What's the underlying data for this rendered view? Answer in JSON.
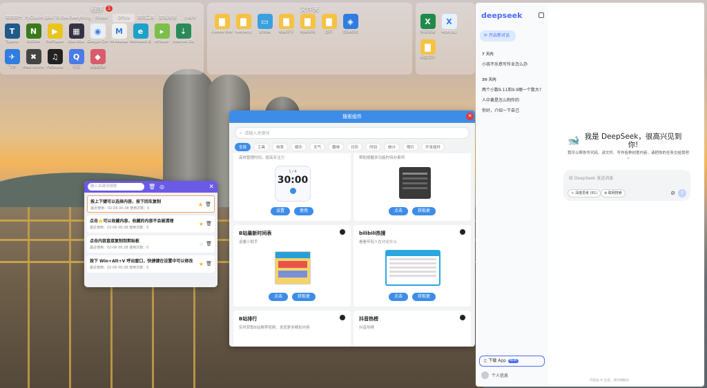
{
  "desktop": {
    "programs": {
      "title": "程序",
      "badge": "1",
      "categories": [
        "常用软件",
        "PyCharm 2022.3",
        "Bat To Exe Converter",
        "Everything",
        "Finder",
        "Office",
        "常用工具",
        "游戏/影音",
        "小程序"
      ],
      "icons": [
        {
          "label": "Typora",
          "icon": "typora-icon",
          "color": "#1f5a8a",
          "glyph": "T"
        },
        {
          "label": "NVIDIA",
          "icon": "nvidia-icon",
          "color": "#3a7a1a",
          "glyph": "N"
        },
        {
          "label": "PotPlayer",
          "icon": "potplayer-icon",
          "color": "#e7c51e",
          "glyph": "▶"
        },
        {
          "label": "Dev Box",
          "icon": "devbox-icon",
          "color": "#334",
          "glyph": "▦"
        },
        {
          "label": "Google Chrome",
          "icon": "chrome-icon",
          "color": "#e9eef5",
          "glyph": "◉"
        },
        {
          "label": "Mindwise",
          "icon": "mindwise-icon",
          "color": "#f0f0f0",
          "glyph": "M"
        },
        {
          "label": "Microsoft Edge",
          "icon": "edge-icon",
          "color": "#1da1c8",
          "glyph": "e"
        },
        {
          "label": "ePlayer",
          "icon": "player-icon",
          "color": "#7bbf4a",
          "glyph": "▸"
        },
        {
          "label": "Internet Download",
          "icon": "idm-icon",
          "color": "#2a8a5a",
          "glyph": "⇣"
        },
        {
          "label": "飞书",
          "icon": "feishu-icon",
          "color": "#2f7de0",
          "glyph": "✈"
        },
        {
          "label": "Hide Uninstaller",
          "icon": "uninstaller-icon",
          "color": "#444",
          "glyph": "✖"
        },
        {
          "label": "FxSound",
          "icon": "fxsound-icon",
          "color": "#222",
          "glyph": "♫"
        },
        {
          "label": "夸克",
          "icon": "quark-icon",
          "color": "#4a7be8",
          "glyph": "Q"
        },
        {
          "label": "桌面整理",
          "icon": "desktop-organizer-icon",
          "color": "#d85c6a",
          "glyph": "◆"
        }
      ]
    },
    "folders": {
      "title": "文件夹",
      "icons": [
        {
          "label": "Cookie Editor",
          "icon": "folder-icon",
          "color": "#f5c244",
          "glyph": "▇"
        },
        {
          "label": "huojiang",
          "icon": "folder-icon",
          "color": "#f5c244",
          "glyph": "▇"
        },
        {
          "label": "此电脑",
          "icon": "computer-icon",
          "color": "#3aa0e0",
          "glyph": "▭"
        },
        {
          "label": "电脑文件",
          "icon": "folder-icon",
          "color": "#f5c244",
          "glyph": "▇"
        },
        {
          "label": "电脑游戏",
          "icon": "folder-icon",
          "color": "#f5c244",
          "glyph": "▇"
        },
        {
          "label": "图片",
          "icon": "folder-icon",
          "color": "#f5c244",
          "glyph": "▇"
        },
        {
          "label": "图像处理",
          "icon": "app-icon",
          "color": "#2f7de0",
          "glyph": "◈"
        }
      ]
    },
    "files": {
      "icons": [
        {
          "label": "恢复数据",
          "icon": "excel-file-icon",
          "color": "#1e8a4c",
          "glyph": "X"
        },
        {
          "label": "logo.jpg",
          "icon": "image-file-icon",
          "color": "#e8f0fb",
          "glyph": "X"
        },
        {
          "label": "网盘文件",
          "icon": "folder-icon",
          "color": "#f5c244",
          "glyph": "▇"
        }
      ]
    }
  },
  "plugin_window": {
    "title": "搜索组件",
    "search_placeholder": "请输入关键词",
    "chips": [
      "全部",
      "工具",
      "效率",
      "娱乐",
      "天气",
      "趣味",
      "日历",
      "时间",
      "统计",
      "照片",
      "开发组件"
    ],
    "cards": [
      {
        "title": "",
        "desc": "高效管理时间，提高专注力",
        "preview": "30:00",
        "preview_sub": "1 / 4",
        "buttons": [
          "设置",
          "使用"
        ]
      },
      {
        "title": "",
        "desc": "帮助提醒多功能的待办事项",
        "preview": "",
        "buttons": [
          "点击",
          "获取更"
        ]
      },
      {
        "title": "B站最新时间表",
        "desc": "追番小助手",
        "buttons": [
          "点击",
          "获取更"
        ]
      },
      {
        "title": "bilibili热搜",
        "desc": "看看年轻人在讨论什么",
        "buttons": [
          "点击",
          "获取更"
        ]
      },
      {
        "title": "B站排行",
        "desc": "实时获取B站推荐视频，发现更多精彩内容",
        "buttons": []
      },
      {
        "title": "抖音热榜",
        "desc": "抖音热榜",
        "buttons": []
      }
    ]
  },
  "clipboard": {
    "search_placeholder": "输入关键词搜索",
    "items": [
      {
        "text": "按上下键可以选择内容，按下回车复制",
        "meta": "最近使用：02-06 00:38   使用次数：0",
        "starred": true
      },
      {
        "text": "点击⭐可以收藏内容，收藏的内容不会被清理",
        "meta": "最近使用：02-06 00:38   使用次数：0",
        "starred": true
      },
      {
        "text": "点击内容直接复制到剪贴板",
        "meta": "最近使用：02-06 00:38   使用次数：0",
        "starred": false
      },
      {
        "text": "按下 Win+Alt+V 呼出窗口，快捷键在设置中可以修改",
        "meta": "最近使用：02-06 00:38   使用次数：0",
        "starred": true
      }
    ]
  },
  "deepseek": {
    "logo": "deepseek",
    "new_chat": "开启新对话",
    "sections": [
      {
        "heading": "7 天内",
        "items": [
          "小孩不乐意写作业怎么办"
        ]
      },
      {
        "heading": "30 天内",
        "items": [
          "两个小数9.11和9.9哪一个数大?",
          "人中黄是怎么制作的",
          "你好，介绍一下自己"
        ]
      }
    ],
    "download_app": "下载 App",
    "new_tag": "NEW",
    "user_label": "个人信息",
    "greeting": "我是 DeepSeek，很高兴见到你!",
    "subtitle": "我可以帮你写代码、读文件、写作各种创意内容，请把你的任务交给我吧~",
    "input_placeholder": "给 DeepSeek 发送消息",
    "mode_deepthink": "深度思考 (R1)",
    "mode_search": "联网搜索",
    "footer": "内容由 AI 生成，请仔细甄别"
  }
}
